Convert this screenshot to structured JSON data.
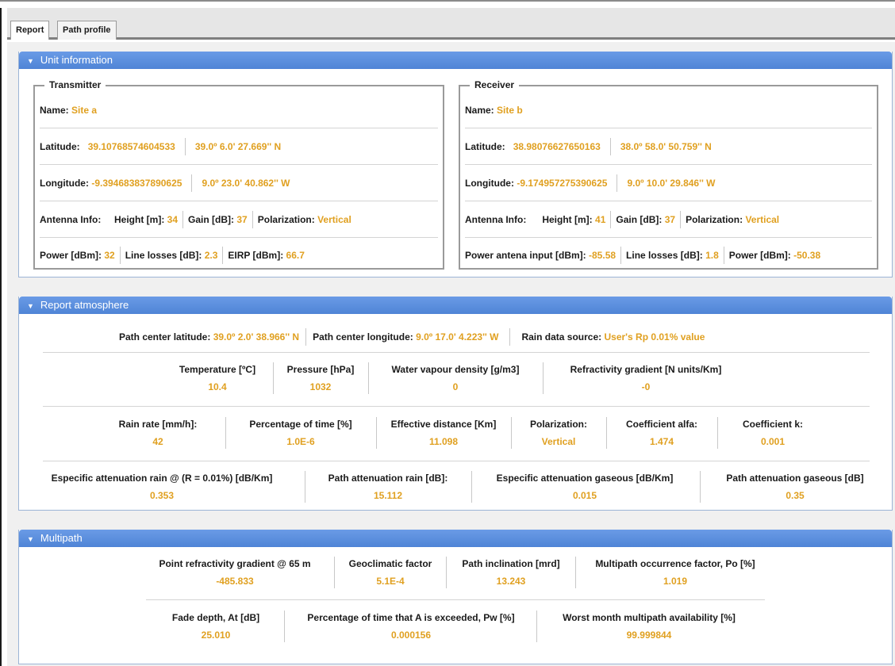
{
  "tabs": [
    "Report",
    "Path profile"
  ],
  "unit_information": {
    "title": "Unit information",
    "transmitter": {
      "legend": "Transmitter",
      "name_label": "Name:",
      "name": "Site a",
      "latitude_label": "Latitude:",
      "latitude_decimal": "39.10768574604533",
      "latitude_dms": "39.0º 6.0' 27.669'' N",
      "longitude_label": "Longitude:",
      "longitude_decimal": "-9.394683837890625",
      "longitude_dms": "9.0º 23.0' 40.862'' W",
      "antenna_label": "Antenna Info:",
      "height_label": "Height [m]:",
      "height": "34",
      "gain_label": "Gain [dB]:",
      "gain": "37",
      "polarization_label": "Polarization:",
      "polarization": "Vertical",
      "power_label": "Power [dBm]:",
      "power": "32",
      "line_losses_label": "Line losses [dB]:",
      "line_losses": "2.3",
      "eirp_label": "EIRP [dBm]:",
      "eirp": "66.7"
    },
    "receiver": {
      "legend": "Receiver",
      "name_label": "Name:",
      "name": "Site b",
      "latitude_label": "Latitude:",
      "latitude_decimal": "38.98076627650163",
      "latitude_dms": "38.0º 58.0' 50.759'' N",
      "longitude_label": "Longitude:",
      "longitude_decimal": "-9.174957275390625",
      "longitude_dms": "9.0º 10.0' 29.846'' W",
      "antenna_label": "Antenna Info:",
      "height_label": "Height [m]:",
      "height": "41",
      "gain_label": "Gain [dB]:",
      "gain": "37",
      "polarization_label": "Polarization:",
      "polarization": "Vertical",
      "power_input_label": "Power antena input [dBm]:",
      "power_input": "-85.58",
      "line_losses_label": "Line losses [dB]:",
      "line_losses": "1.8",
      "power_label": "Power [dBm]:",
      "power": "-50.38"
    }
  },
  "report_atmosphere": {
    "title": "Report atmosphere",
    "path_center_lat_label": "Path center latitude:",
    "path_center_lat": "39.0º 2.0' 38.966'' N",
    "path_center_lon_label": "Path center longitude:",
    "path_center_lon": "9.0º 17.0' 4.223'' W",
    "rain_source_label": "Rain data source:",
    "rain_source": "User's Rp 0.01% value",
    "row1": [
      {
        "label": "Temperature [ºC]",
        "value": "10.4"
      },
      {
        "label": "Pressure [hPa]",
        "value": "1032"
      },
      {
        "label": "Water vapour density [g/m3]",
        "value": "0"
      },
      {
        "label": "Refractivity gradient [N units/Km]",
        "value": "-0"
      }
    ],
    "row2": [
      {
        "label": "Rain rate [mm/h]:",
        "value": "42"
      },
      {
        "label": "Percentage of time [%]",
        "value": "1.0E-6"
      },
      {
        "label": "Effective distance [Km]",
        "value": "11.098"
      },
      {
        "label": "Polarization:",
        "value": "Vertical"
      },
      {
        "label": "Coefficient alfa:",
        "value": "1.474"
      },
      {
        "label": "Coefficient k:",
        "value": "0.001"
      }
    ],
    "row3": [
      {
        "label": "Especific attenuation rain @ (R = 0.01%) [dB/Km]",
        "value": "0.353"
      },
      {
        "label": "Path attenuation rain [dB]:",
        "value": "15.112"
      },
      {
        "label": "Especific attenuation gaseous [dB/Km]",
        "value": "0.015"
      },
      {
        "label": "Path attenuation gaseous [dB]",
        "value": "0.35"
      }
    ]
  },
  "multipath": {
    "title": "Multipath",
    "row1": [
      {
        "label": "Point refractivity gradient @ 65 m",
        "value": "-485.833"
      },
      {
        "label": "Geoclimatic factor",
        "value": "5.1E-4"
      },
      {
        "label": "Path inclination [mrd]",
        "value": "13.243"
      },
      {
        "label": "Multipath occurrence factor, Po [%]",
        "value": "1.019"
      }
    ],
    "row2": [
      {
        "label": "Fade depth, At [dB]",
        "value": "25.010"
      },
      {
        "label": "Percentage of time that A is exceeded, Pw [%]",
        "value": "0.000156"
      },
      {
        "label": "Worst month multipath availability [%]",
        "value": "99.999844"
      }
    ]
  }
}
